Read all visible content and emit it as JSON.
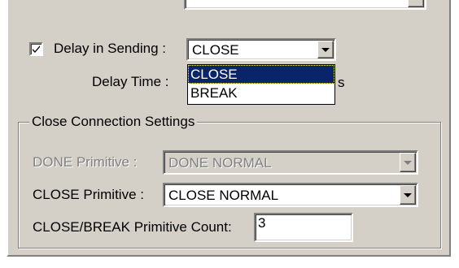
{
  "delay": {
    "checkbox_label": "Delay in Sending :",
    "checked": true,
    "selected": "CLOSE",
    "options": [
      "CLOSE",
      "BREAK"
    ],
    "highlighted_option": "CLOSE",
    "time_label": "Delay Time :",
    "time_unit_partial": "s"
  },
  "close_group": {
    "title": "Close Connection Settings",
    "done_label": "DONE Primitive :",
    "done_value": "DONE NORMAL",
    "close_label": "CLOSE Primitive :",
    "close_value": "CLOSE NORMAL",
    "count_label": "CLOSE/BREAK Primitive Count:",
    "count_value": "3"
  },
  "colors": {
    "panel": "#d4d0c8",
    "selection": "#0a246a"
  }
}
